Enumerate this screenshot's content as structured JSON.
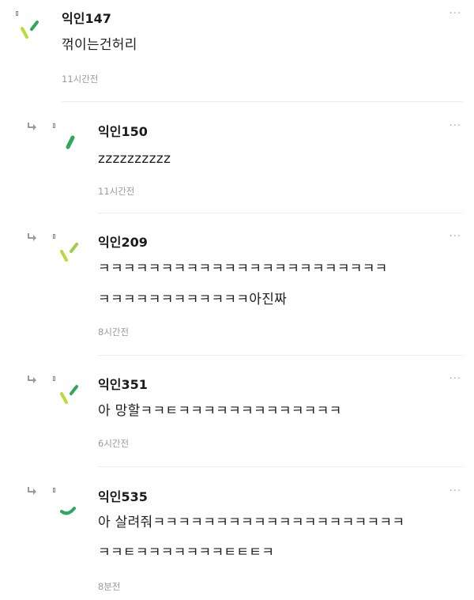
{
  "comments": [
    {
      "author": "익인147",
      "lines": [
        "꺾이는건허리"
      ],
      "time": "11시간전",
      "more_icon": "···",
      "reply": false,
      "avatar_color": "#b9dc3c"
    },
    {
      "author": "익인150",
      "lines": [
        "zzzzzzzzzz"
      ],
      "time": "11시간전",
      "more_icon": "···",
      "reply": true,
      "avatar_color": "#2ea85a"
    },
    {
      "author": "익인209",
      "lines": [
        "ㅋㅋㅋㅋㅋㅋㅋㅋㅋㅋㅋㅋㅋㅋㅋㅋㅋㅋㅋㅋㅋㅋㅋ",
        "ㅋㅋㅋㅋㅋㅋㅋㅋㅋㅋㅋㅋ아진짜"
      ],
      "time": "8시간전",
      "more_icon": "···",
      "reply": true,
      "avatar_color": "#b9dc3c"
    },
    {
      "author": "익인351",
      "lines": [
        "아 망할ㅋㅋㅌㅋㅋㅋㅋㅋㅋㅋㅋㅋㅋㅋㅋㅋ"
      ],
      "time": "6시간전",
      "more_icon": "···",
      "reply": true,
      "avatar_color": "#b9dc3c"
    },
    {
      "author": "익인535",
      "lines": [
        "아 살려줘ㅋㅋㅋㅋㅋㅋㅋㅋㅋㅋㅋㅋㅋㅋㅋㅋㅋㅋㅋㅋ",
        "ㅋㅋㅌㅋㅋㅋㅋㅋㅋㅋㅌㅌㅌㅋ"
      ],
      "time": "8분전",
      "more_icon": "···",
      "reply": true,
      "avatar_color": "#2ea85a"
    }
  ]
}
